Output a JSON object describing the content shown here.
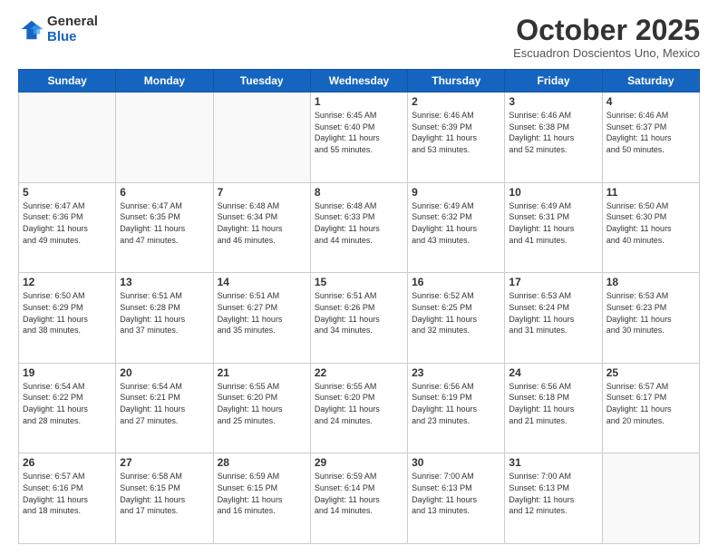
{
  "logo": {
    "general": "General",
    "blue": "Blue"
  },
  "header": {
    "month": "October 2025",
    "location": "Escuadron Doscientos Uno, Mexico"
  },
  "days_of_week": [
    "Sunday",
    "Monday",
    "Tuesday",
    "Wednesday",
    "Thursday",
    "Friday",
    "Saturday"
  ],
  "weeks": [
    [
      {
        "day": "",
        "info": ""
      },
      {
        "day": "",
        "info": ""
      },
      {
        "day": "",
        "info": ""
      },
      {
        "day": "1",
        "info": "Sunrise: 6:45 AM\nSunset: 6:40 PM\nDaylight: 11 hours\nand 55 minutes."
      },
      {
        "day": "2",
        "info": "Sunrise: 6:46 AM\nSunset: 6:39 PM\nDaylight: 11 hours\nand 53 minutes."
      },
      {
        "day": "3",
        "info": "Sunrise: 6:46 AM\nSunset: 6:38 PM\nDaylight: 11 hours\nand 52 minutes."
      },
      {
        "day": "4",
        "info": "Sunrise: 6:46 AM\nSunset: 6:37 PM\nDaylight: 11 hours\nand 50 minutes."
      }
    ],
    [
      {
        "day": "5",
        "info": "Sunrise: 6:47 AM\nSunset: 6:36 PM\nDaylight: 11 hours\nand 49 minutes."
      },
      {
        "day": "6",
        "info": "Sunrise: 6:47 AM\nSunset: 6:35 PM\nDaylight: 11 hours\nand 47 minutes."
      },
      {
        "day": "7",
        "info": "Sunrise: 6:48 AM\nSunset: 6:34 PM\nDaylight: 11 hours\nand 46 minutes."
      },
      {
        "day": "8",
        "info": "Sunrise: 6:48 AM\nSunset: 6:33 PM\nDaylight: 11 hours\nand 44 minutes."
      },
      {
        "day": "9",
        "info": "Sunrise: 6:49 AM\nSunset: 6:32 PM\nDaylight: 11 hours\nand 43 minutes."
      },
      {
        "day": "10",
        "info": "Sunrise: 6:49 AM\nSunset: 6:31 PM\nDaylight: 11 hours\nand 41 minutes."
      },
      {
        "day": "11",
        "info": "Sunrise: 6:50 AM\nSunset: 6:30 PM\nDaylight: 11 hours\nand 40 minutes."
      }
    ],
    [
      {
        "day": "12",
        "info": "Sunrise: 6:50 AM\nSunset: 6:29 PM\nDaylight: 11 hours\nand 38 minutes."
      },
      {
        "day": "13",
        "info": "Sunrise: 6:51 AM\nSunset: 6:28 PM\nDaylight: 11 hours\nand 37 minutes."
      },
      {
        "day": "14",
        "info": "Sunrise: 6:51 AM\nSunset: 6:27 PM\nDaylight: 11 hours\nand 35 minutes."
      },
      {
        "day": "15",
        "info": "Sunrise: 6:51 AM\nSunset: 6:26 PM\nDaylight: 11 hours\nand 34 minutes."
      },
      {
        "day": "16",
        "info": "Sunrise: 6:52 AM\nSunset: 6:25 PM\nDaylight: 11 hours\nand 32 minutes."
      },
      {
        "day": "17",
        "info": "Sunrise: 6:53 AM\nSunset: 6:24 PM\nDaylight: 11 hours\nand 31 minutes."
      },
      {
        "day": "18",
        "info": "Sunrise: 6:53 AM\nSunset: 6:23 PM\nDaylight: 11 hours\nand 30 minutes."
      }
    ],
    [
      {
        "day": "19",
        "info": "Sunrise: 6:54 AM\nSunset: 6:22 PM\nDaylight: 11 hours\nand 28 minutes."
      },
      {
        "day": "20",
        "info": "Sunrise: 6:54 AM\nSunset: 6:21 PM\nDaylight: 11 hours\nand 27 minutes."
      },
      {
        "day": "21",
        "info": "Sunrise: 6:55 AM\nSunset: 6:20 PM\nDaylight: 11 hours\nand 25 minutes."
      },
      {
        "day": "22",
        "info": "Sunrise: 6:55 AM\nSunset: 6:20 PM\nDaylight: 11 hours\nand 24 minutes."
      },
      {
        "day": "23",
        "info": "Sunrise: 6:56 AM\nSunset: 6:19 PM\nDaylight: 11 hours\nand 23 minutes."
      },
      {
        "day": "24",
        "info": "Sunrise: 6:56 AM\nSunset: 6:18 PM\nDaylight: 11 hours\nand 21 minutes."
      },
      {
        "day": "25",
        "info": "Sunrise: 6:57 AM\nSunset: 6:17 PM\nDaylight: 11 hours\nand 20 minutes."
      }
    ],
    [
      {
        "day": "26",
        "info": "Sunrise: 6:57 AM\nSunset: 6:16 PM\nDaylight: 11 hours\nand 18 minutes."
      },
      {
        "day": "27",
        "info": "Sunrise: 6:58 AM\nSunset: 6:15 PM\nDaylight: 11 hours\nand 17 minutes."
      },
      {
        "day": "28",
        "info": "Sunrise: 6:59 AM\nSunset: 6:15 PM\nDaylight: 11 hours\nand 16 minutes."
      },
      {
        "day": "29",
        "info": "Sunrise: 6:59 AM\nSunset: 6:14 PM\nDaylight: 11 hours\nand 14 minutes."
      },
      {
        "day": "30",
        "info": "Sunrise: 7:00 AM\nSunset: 6:13 PM\nDaylight: 11 hours\nand 13 minutes."
      },
      {
        "day": "31",
        "info": "Sunrise: 7:00 AM\nSunset: 6:13 PM\nDaylight: 11 hours\nand 12 minutes."
      },
      {
        "day": "",
        "info": ""
      }
    ]
  ]
}
